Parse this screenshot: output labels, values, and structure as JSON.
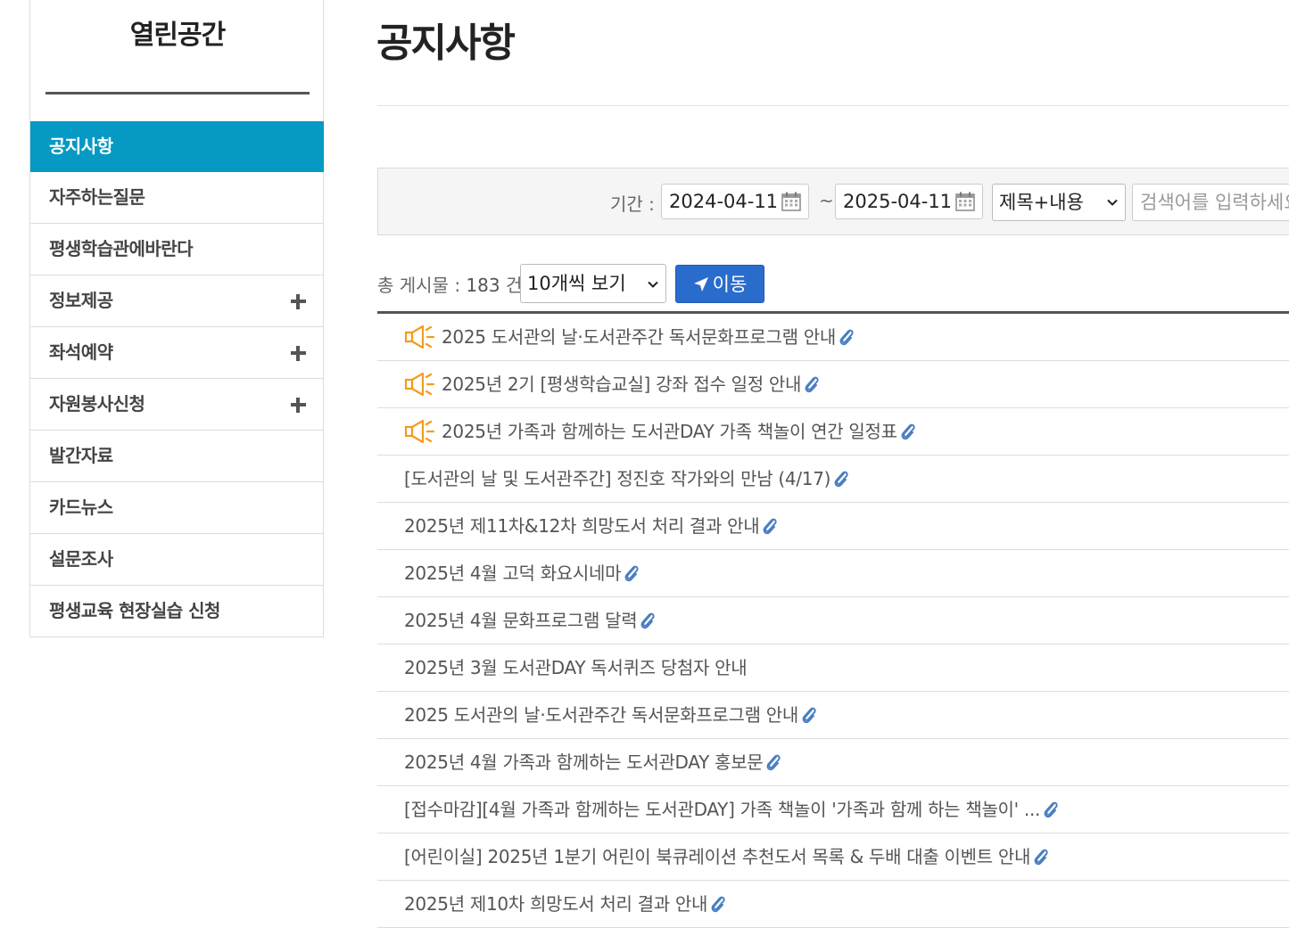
{
  "sidebar": {
    "title": "열린공간",
    "items": [
      {
        "label": "공지사항",
        "active": true,
        "expandable": false
      },
      {
        "label": "자주하는질문",
        "active": false,
        "expandable": false
      },
      {
        "label": "평생학습관에바란다",
        "active": false,
        "expandable": false
      },
      {
        "label": "정보제공",
        "active": false,
        "expandable": true
      },
      {
        "label": "좌석예약",
        "active": false,
        "expandable": true
      },
      {
        "label": "자원봉사신청",
        "active": false,
        "expandable": true
      },
      {
        "label": "발간자료",
        "active": false,
        "expandable": false
      },
      {
        "label": "카드뉴스",
        "active": false,
        "expandable": false
      },
      {
        "label": "설문조사",
        "active": false,
        "expandable": false
      },
      {
        "label": "평생교육 현장실습 신청",
        "active": false,
        "expandable": false
      }
    ],
    "active_color": "#0599c4"
  },
  "main": {
    "page_title": "공지사항",
    "search": {
      "period_label": "기간 :",
      "start_date": "2024-04-11",
      "separator": "~",
      "end_date": "2025-04-11",
      "field_selected": "제목+내용",
      "keyword_placeholder": "검색어를 입력하세요"
    },
    "listing": {
      "total_label": "총 게시물 : ",
      "total_count": "183",
      "total_unit": " 건",
      "per_page_selected": "10개씩 보기",
      "go_button": "이동",
      "button_color": "#2a6ccc"
    },
    "notices": [
      {
        "title": "2025 도서관의 날·도서관주간 독서문화프로그램 안내",
        "pinned": true,
        "attachment": true
      },
      {
        "title": "2025년 2기 [평생학습교실] 강좌 접수 일정 안내",
        "pinned": true,
        "attachment": true
      },
      {
        "title": "2025년 가족과 함께하는 도서관DAY 가족 책놀이 연간 일정표",
        "pinned": true,
        "attachment": true
      },
      {
        "title": "[도서관의 날 및 도서관주간] 정진호 작가와의 만남 (4/17)",
        "pinned": false,
        "attachment": true
      },
      {
        "title": "2025년 제11차&12차 희망도서 처리 결과 안내",
        "pinned": false,
        "attachment": true
      },
      {
        "title": "2025년 4월 고덕 화요시네마",
        "pinned": false,
        "attachment": true
      },
      {
        "title": "2025년 4월 문화프로그램 달력",
        "pinned": false,
        "attachment": true
      },
      {
        "title": "2025년 3월 도서관DAY 독서퀴즈 당첨자 안내",
        "pinned": false,
        "attachment": false
      },
      {
        "title": "2025 도서관의 날·도서관주간 독서문화프로그램 안내",
        "pinned": false,
        "attachment": true
      },
      {
        "title": "2025년 4월 가족과 함께하는 도서관DAY 홍보문",
        "pinned": false,
        "attachment": true
      },
      {
        "title": "[접수마감][4월 가족과 함께하는 도서관DAY] 가족 책놀이 '가족과 함께 하는 책놀이' ...",
        "pinned": false,
        "attachment": true
      },
      {
        "title": "[어린이실] 2025년 1분기 어린이 북큐레이션 추천도서 목록 & 두배 대출 이벤트 안내",
        "pinned": false,
        "attachment": true
      },
      {
        "title": "2025년 제10차 희망도서 처리 결과 안내",
        "pinned": false,
        "attachment": true
      }
    ],
    "pinned_icon_color": "#f39c1f",
    "attachment_icon_color": "#4a7fc1"
  }
}
